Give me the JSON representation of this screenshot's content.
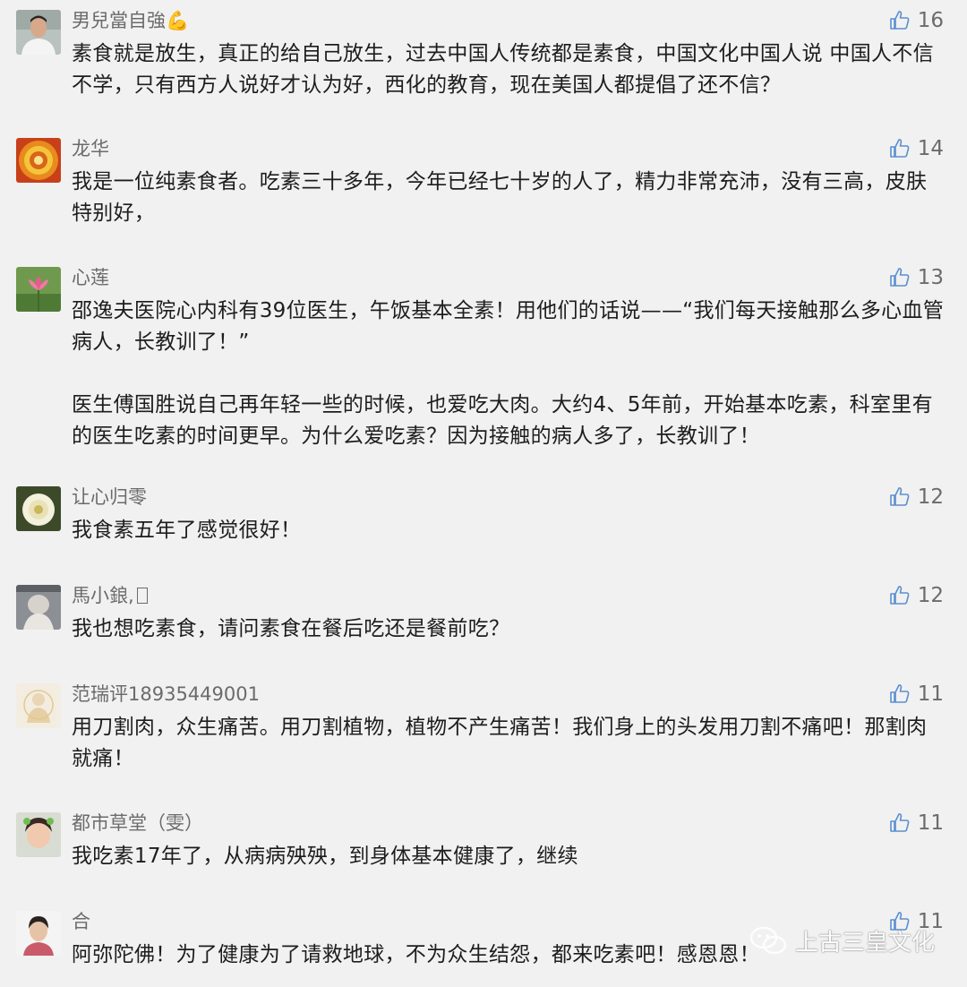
{
  "comments": [
    {
      "name": "男兒當自強💪",
      "likes": "16",
      "avatar": "avatar-young-man",
      "lines": [
        "素食就是放生，真正的给自己放生，过去中国人传统都是素食，中国文化中国人说 中国人不信不学，只有西方人说好才认为好，西化的教育，现在美国人都提倡了还不信？"
      ]
    },
    {
      "name": "龙华",
      "likes": "14",
      "avatar": "avatar-mandala",
      "lines": [
        "我是一位纯素食者。吃素三十多年，今年已经七十岁的人了，精力非常充沛，没有三高，皮肤特别好，"
      ]
    },
    {
      "name": "心莲",
      "likes": "13",
      "avatar": "avatar-lotus",
      "lines": [
        "邵逸夫医院心内科有39位医生，午饭基本全素！用他们的话说——“我们每天接触那么多心血管病人，长教训了！”",
        "医生傅国胜说自己再年轻一些的时候，也爱吃大肉。大约4、5年前，开始基本吃素，科室里有的医生吃素的时间更早。为什么爱吃素？因为接触的病人多了，长教训了！"
      ]
    },
    {
      "name": "让心归零",
      "likes": "12",
      "avatar": "avatar-white-flower",
      "lines": [
        "我食素五年了感觉很好！"
      ]
    },
    {
      "name": "馬小鋃,",
      "likes": "12",
      "avatar": "avatar-baby",
      "lines": [
        "我也想吃素食，请问素食在餐后吃还是餐前吃？"
      ]
    },
    {
      "name": "范瑞评18935449001",
      "likes": "11",
      "avatar": "avatar-buddha",
      "lines": [
        "用刀割肉，众生痛苦。用刀割植物，植物不产生痛苦！我们身上的头发用刀割不痛吧！那割肉就痛！"
      ]
    },
    {
      "name": "都市草堂（雯）",
      "likes": "11",
      "avatar": "avatar-girl",
      "lines": [
        "我吃素17年了，从病病殃殃，到身体基本健康了，继续"
      ]
    },
    {
      "name": "合",
      "likes": "11",
      "avatar": "avatar-older-woman",
      "lines": [
        "阿弥陀佛！为了健康为了请救地球，不为众生结怨，都来吃素吧！感恩恩！"
      ]
    }
  ],
  "watermark": {
    "text": "上古三皇文化",
    "icon": "wechat-icon"
  }
}
